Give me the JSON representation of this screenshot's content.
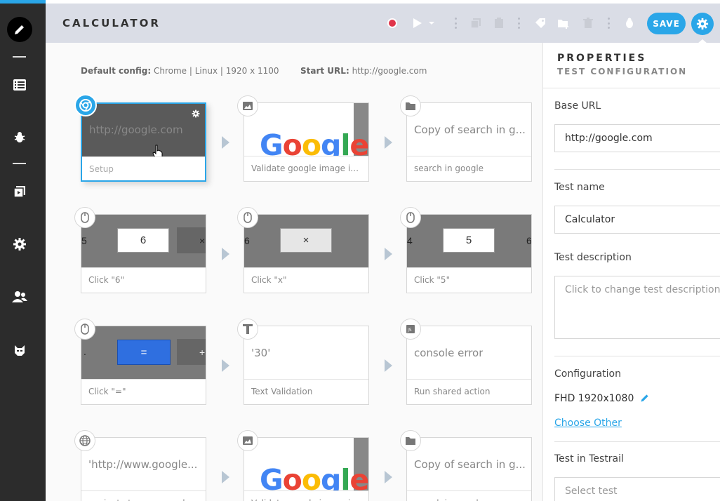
{
  "header": {
    "title": "CALCULATOR",
    "save_label": "SAVE"
  },
  "config": {
    "default_label": "Default config:",
    "default_value": "Chrome | Linux | 1920 x 1100",
    "start_label": "Start URL:",
    "start_value": "http://google.com"
  },
  "steps": [
    {
      "thumb_text": "http://google.com",
      "label": "Setup",
      "badge": "chrome-icon"
    },
    {
      "thumb_text": "Google",
      "label": "Validate google image is ...",
      "badge": "image-icon"
    },
    {
      "thumb_text": "Copy of search in g...",
      "label": "search in google",
      "badge": "folder-icon"
    },
    {
      "key": "6",
      "left": "5",
      "right": "×",
      "label": "Click \"6\"",
      "badge": "mouse-icon"
    },
    {
      "key": "×",
      "left": "6",
      "label": "Click \"x\"",
      "badge": "mouse-icon"
    },
    {
      "key": "5",
      "left": "4",
      "right": "6",
      "label": "Click \"5\"",
      "badge": "mouse-icon"
    },
    {
      "key": "=",
      "left": ".",
      "right": "+",
      "label": "Click \"=\"",
      "badge": "mouse-icon"
    },
    {
      "thumb_text": "'30'",
      "label": "Text Validation",
      "badge": "text-icon"
    },
    {
      "thumb_text": "console error",
      "label": "Run shared action",
      "badge": "js-icon"
    },
    {
      "thumb_text": "'http://www.google...",
      "label": "navigate to www.google...",
      "badge": "globe-icon"
    },
    {
      "thumb_text": "Google",
      "label": "Validate google image is ...",
      "badge": "image-icon"
    },
    {
      "thumb_text": "Copy of search in g...",
      "label": "search in google",
      "badge": "folder-icon"
    }
  ],
  "properties": {
    "title": "PROPERTIES",
    "subtitle": "TEST CONFIGURATION",
    "base_url_label": "Base URL",
    "base_url_value": "http://google.com",
    "test_name_label": "Test name",
    "test_name_value": "Calculator",
    "test_description_label": "Test description",
    "test_description_placeholder": "Click to change test description",
    "configuration_label": "Configuration",
    "configuration_value": "FHD 1920x1080",
    "choose_other": "Choose Other",
    "testrail_label": "Test in Testrail",
    "testrail_placeholder": "Select test"
  },
  "colors": {
    "accent": "#2aa6e8",
    "sidebar": "#2c2c2c",
    "header": "#dadde6",
    "record": "#e0344a"
  }
}
